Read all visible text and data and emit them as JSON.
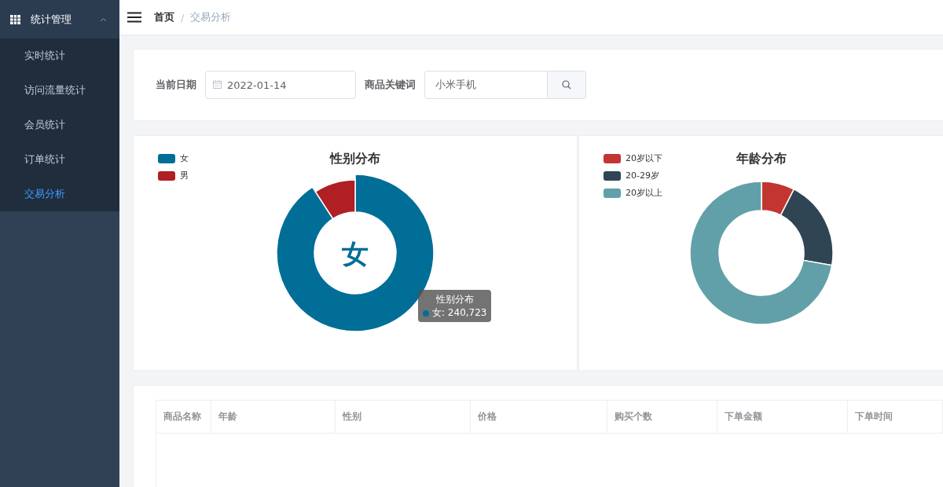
{
  "sidebar": {
    "group": {
      "label": "统计管理",
      "expanded": true
    },
    "items": [
      {
        "label": "实时统计",
        "selected": false
      },
      {
        "label": "访问流量统计",
        "selected": false
      },
      {
        "label": "会员统计",
        "selected": false
      },
      {
        "label": "订单统计",
        "selected": false
      },
      {
        "label": "交易分析",
        "selected": true
      }
    ]
  },
  "breadcrumb": [
    "首页",
    "交易分析"
  ],
  "breadcrumb_separator": "/",
  "filters": {
    "date_label": "当前日期",
    "date_value": "2022-01-14",
    "keyword_label": "商品关键词",
    "keyword_value": "小米手机"
  },
  "gender_chart": {
    "title": "性别分布",
    "center_label": "女",
    "legend": [
      {
        "label": "女",
        "color": "#006e96"
      },
      {
        "label": "男",
        "color": "#b01f24"
      }
    ],
    "tooltip": {
      "title": "性别分布",
      "text": "女: 240,723",
      "color": "#006e96"
    }
  },
  "age_chart": {
    "title": "年龄分布",
    "legend": [
      {
        "label": "20岁以下",
        "color": "#c23531"
      },
      {
        "label": "20-29岁",
        "color": "#2f4554"
      },
      {
        "label": "20岁以上",
        "color": "#61a0a8"
      }
    ]
  },
  "table": {
    "columns": [
      "商品名称",
      "年龄",
      "性别",
      "价格",
      "购买个数",
      "下单金额",
      "下单时间"
    ]
  }
}
